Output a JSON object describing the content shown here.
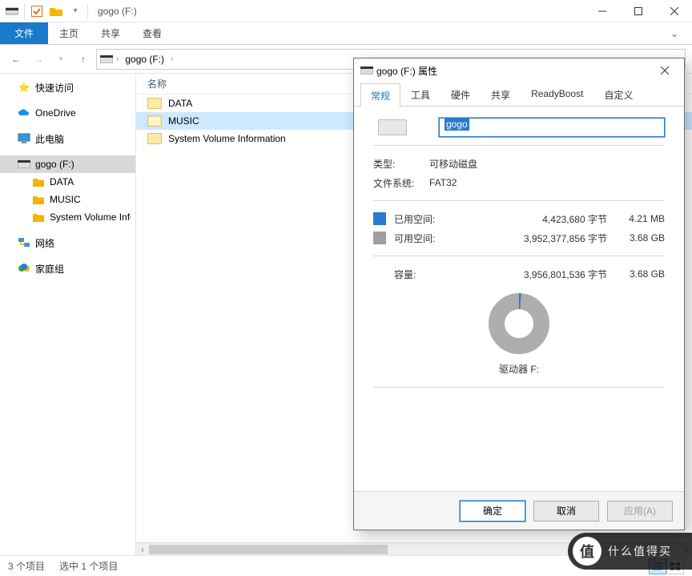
{
  "titlebar": {
    "title": "gogo (F:)"
  },
  "ribbon": {
    "file": "文件",
    "tabs": [
      "主页",
      "共享",
      "查看"
    ]
  },
  "address": {
    "crumb": "gogo (F:)"
  },
  "tree": {
    "quick": "快速访问",
    "onedrive": "OneDrive",
    "thispc": "此电脑",
    "drive": "gogo (F:)",
    "sub": [
      "DATA",
      "MUSIC",
      "System Volume Information"
    ],
    "network": "网络",
    "homegroup": "家庭组"
  },
  "list": {
    "header": "名称",
    "rows": [
      "DATA",
      "MUSIC",
      "System Volume Information"
    ]
  },
  "status": {
    "count": "3 个项目",
    "selected": "选中 1 个项目"
  },
  "dialog": {
    "title": "gogo (F:) 属性",
    "tabs": [
      "常规",
      "工具",
      "硬件",
      "共享",
      "ReadyBoost",
      "自定义"
    ],
    "name": "gogo",
    "type_label": "类型:",
    "type_value": "可移动磁盘",
    "fs_label": "文件系统:",
    "fs_value": "FAT32",
    "used_label": "已用空间:",
    "used_bytes": "4,423,680 字节",
    "used_human": "4.21 MB",
    "free_label": "可用空间:",
    "free_bytes": "3,952,377,856 字节",
    "free_human": "3.68 GB",
    "cap_label": "容量:",
    "cap_bytes": "3,956,801,536 字节",
    "cap_human": "3.68 GB",
    "drive_caption": "驱动器 F:",
    "ok": "确定",
    "cancel": "取消",
    "apply": "应用(A)"
  },
  "watermark": "什么值得买"
}
